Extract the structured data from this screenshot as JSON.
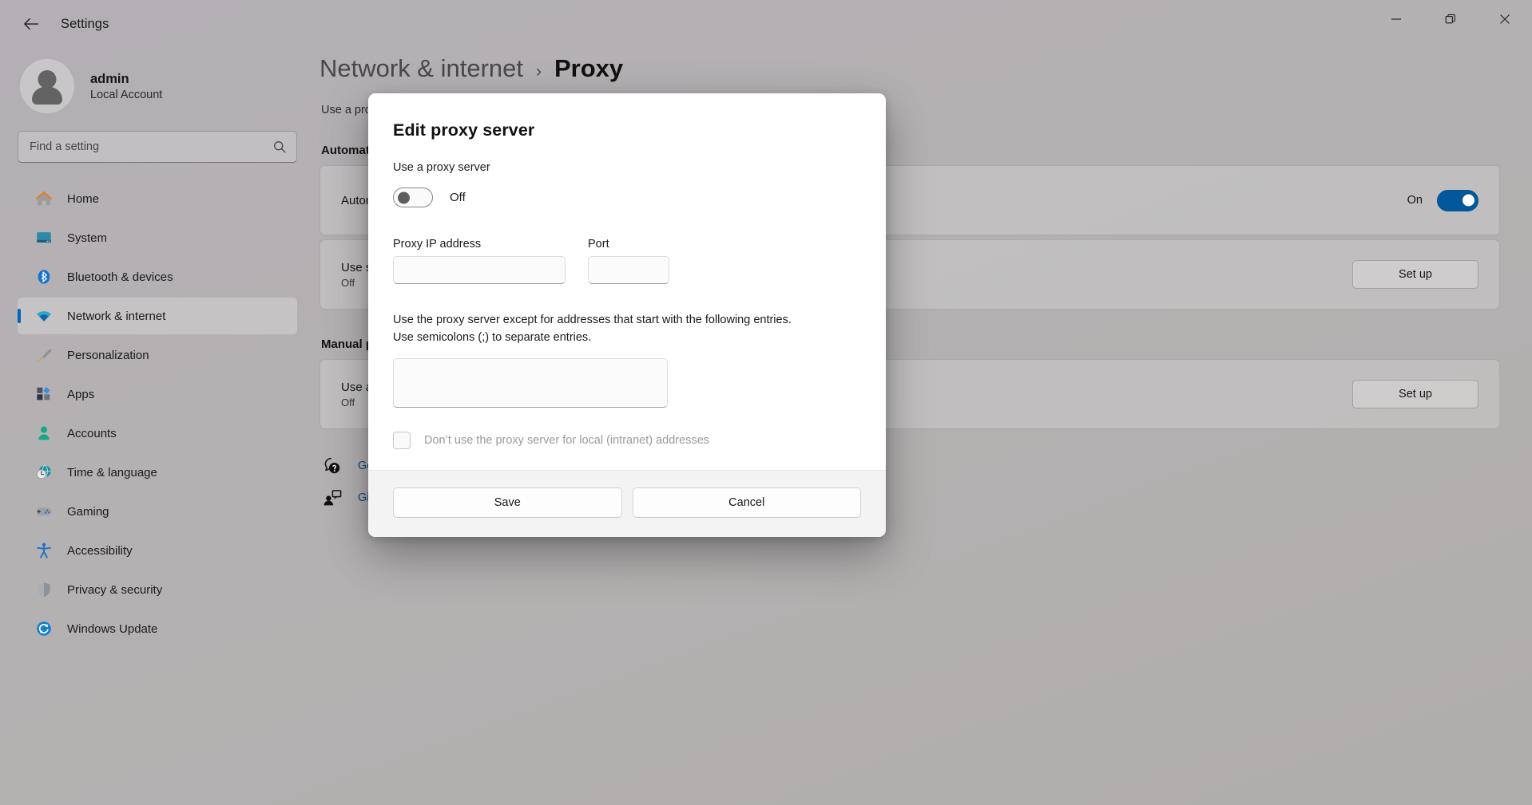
{
  "window": {
    "app_title": "Settings",
    "back_icon": "back-arrow-icon",
    "controls": {
      "minimize": "minimize-icon",
      "restore": "restore-icon",
      "close": "close-icon"
    }
  },
  "sidebar": {
    "account": {
      "name": "admin",
      "type": "Local Account"
    },
    "search": {
      "placeholder": "Find a setting",
      "value": "",
      "icon": "search-icon"
    },
    "items": [
      {
        "label": "Home",
        "icon": "home-icon",
        "active": false
      },
      {
        "label": "System",
        "icon": "system-icon",
        "active": false
      },
      {
        "label": "Bluetooth & devices",
        "icon": "bluetooth-icon",
        "active": false
      },
      {
        "label": "Network & internet",
        "icon": "wifi-icon",
        "active": true
      },
      {
        "label": "Personalization",
        "icon": "paintbrush-icon",
        "active": false
      },
      {
        "label": "Apps",
        "icon": "apps-icon",
        "active": false
      },
      {
        "label": "Accounts",
        "icon": "account-icon",
        "active": false
      },
      {
        "label": "Time & language",
        "icon": "clock-globe-icon",
        "active": false
      },
      {
        "label": "Gaming",
        "icon": "gamepad-icon",
        "active": false
      },
      {
        "label": "Accessibility",
        "icon": "accessibility-icon",
        "active": false
      },
      {
        "label": "Privacy & security",
        "icon": "shield-icon",
        "active": false
      },
      {
        "label": "Windows Update",
        "icon": "update-icon",
        "active": false
      }
    ]
  },
  "content": {
    "breadcrumb": {
      "parent": "Network & internet",
      "separator": "›",
      "current": "Proxy"
    },
    "page_description": "Use a proxy server for Ethernet or Wi-Fi connections.",
    "automatic_section": {
      "title": "Automatic proxy setup",
      "rows": [
        {
          "title": "Automatically detect settings",
          "subtitle": "",
          "toggle_label": "On",
          "toggle_state": "on"
        },
        {
          "title": "Use setup script",
          "subtitle": "Off",
          "button_label": "Set up"
        }
      ]
    },
    "manual_section": {
      "title": "Manual proxy setup",
      "rows": [
        {
          "title": "Use a proxy server",
          "subtitle": "Off",
          "button_label": "Set up"
        }
      ]
    },
    "links": [
      {
        "label": "Get help",
        "icon": "help-question-icon"
      },
      {
        "label": "Give feedback",
        "icon": "feedback-person-icon"
      }
    ]
  },
  "dialog": {
    "title": "Edit proxy server",
    "use_proxy_label": "Use a proxy server",
    "toggle_state_label": "Off",
    "toggle_state": "off",
    "ip_field": {
      "label": "Proxy IP address",
      "value": "",
      "placeholder": ""
    },
    "port_field": {
      "label": "Port",
      "value": "",
      "placeholder": ""
    },
    "exception_help_line1": "Use the proxy server except for addresses that start with the following entries.",
    "exception_help_line2": "Use semicolons (;) to separate entries.",
    "exception_value": "",
    "local_checkbox_label": "Don’t use the proxy server for local (intranet) addresses",
    "local_checkbox_checked": false,
    "save_label": "Save",
    "cancel_label": "Cancel"
  },
  "colors": {
    "accent": "#005799",
    "link": "#12487e",
    "window_bg": "#b2aeb3",
    "dialog_bg": "#ffffff",
    "footer_bg": "#f3f3f3"
  }
}
